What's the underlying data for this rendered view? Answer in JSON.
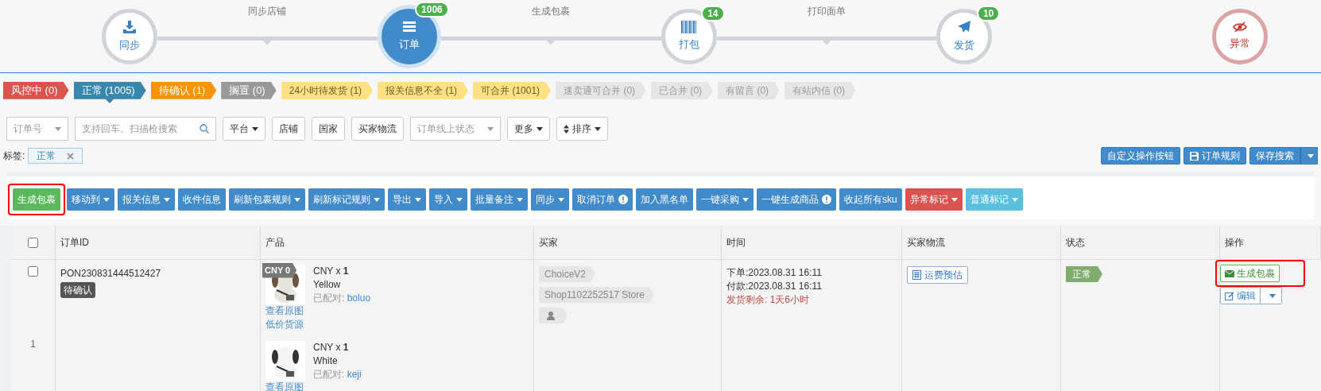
{
  "steps": [
    {
      "label": "同步",
      "selected": false,
      "kind": "normal"
    },
    {
      "link": "同步店铺"
    },
    {
      "label": "订单",
      "badge": "1006",
      "selected": true,
      "kind": "normal"
    },
    {
      "link": "生成包裹"
    },
    {
      "label": "打包",
      "badge": "14",
      "selected": false,
      "kind": "normal"
    },
    {
      "link": "打印面单"
    },
    {
      "label": "发货",
      "badge": "10",
      "selected": false,
      "kind": "normal"
    },
    {
      "label": "异常",
      "selected": false,
      "kind": "alert"
    }
  ],
  "status_tags": [
    {
      "label": "风控中 (0)",
      "color": "#d9534f",
      "selected": false
    },
    {
      "label": "正常 (1005)",
      "color": "#3a87ad",
      "selected": true
    },
    {
      "label": "待确认 (1)",
      "color": "#f89406",
      "selected": false
    },
    {
      "label": "搁置 (0)",
      "color": "#999999",
      "selected": false
    },
    {
      "label": "24小时待发货 (1)",
      "color": "#ffe083",
      "selected": false
    },
    {
      "label": "报关信息不全 (1)",
      "color": "#ffe083",
      "selected": false
    },
    {
      "label": "可合并 (1001)",
      "color": "#ffe083",
      "selected": false
    },
    {
      "label": "速卖通可合并 (0)",
      "color": "#e6e6e6",
      "selected": false
    },
    {
      "label": "已合并 (0)",
      "color": "#e6e6e6",
      "selected": false
    },
    {
      "label": "有留言 (0)",
      "color": "#e6e6e6",
      "selected": false
    },
    {
      "label": "有站内信 (0)",
      "color": "#e6e6e6",
      "selected": false
    }
  ],
  "filters": [
    {
      "kind": "select",
      "placeholder": "订单号"
    },
    {
      "kind": "search",
      "placeholder": "支持回车、扫描枪搜索"
    },
    {
      "kind": "dropdown",
      "label": "平台"
    },
    {
      "kind": "button",
      "label": "店铺"
    },
    {
      "kind": "button",
      "label": "国家"
    },
    {
      "kind": "button",
      "label": "买家物流"
    },
    {
      "kind": "select",
      "placeholder": "订单线上状态"
    },
    {
      "kind": "dropdown",
      "label": "更多"
    },
    {
      "kind": "sort",
      "label": "排序"
    }
  ],
  "label_filter": {
    "label": "标签:",
    "tag": "正常"
  },
  "right_actions": [
    {
      "label": "自定义操作按钮",
      "caret": false
    },
    {
      "label": "订单规则",
      "caret": false
    },
    {
      "label": "保存搜索",
      "caret": true
    }
  ],
  "toolbar": [
    {
      "label": "生成包裹",
      "color": "#5cb85c",
      "caret": false,
      "info": false,
      "highlighted": true
    },
    {
      "label": "移动到",
      "color": "#428bca",
      "caret": true,
      "info": false,
      "highlighted": false
    },
    {
      "label": "报关信息",
      "color": "#428bca",
      "caret": true,
      "info": false,
      "highlighted": false
    },
    {
      "label": "收件信息",
      "color": "#428bca",
      "caret": false,
      "info": false,
      "highlighted": false
    },
    {
      "label": "刷新包裹规则",
      "color": "#428bca",
      "caret": true,
      "info": false,
      "highlighted": false
    },
    {
      "label": "刷新标记规则",
      "color": "#428bca",
      "caret": true,
      "info": false,
      "highlighted": false
    },
    {
      "label": "导出",
      "color": "#428bca",
      "caret": true,
      "info": false,
      "highlighted": false
    },
    {
      "label": "导入",
      "color": "#428bca",
      "caret": true,
      "info": false,
      "highlighted": false
    },
    {
      "label": "批量备注",
      "color": "#428bca",
      "caret": true,
      "info": false,
      "highlighted": false
    },
    {
      "label": "同步",
      "color": "#428bca",
      "caret": true,
      "info": false,
      "highlighted": false
    },
    {
      "label": "取消订单",
      "color": "#428bca",
      "caret": false,
      "info": true,
      "highlighted": false
    },
    {
      "label": "加入黑名单",
      "color": "#428bca",
      "caret": false,
      "info": false,
      "highlighted": false
    },
    {
      "label": "一键采购",
      "color": "#428bca",
      "caret": true,
      "info": false,
      "highlighted": false
    },
    {
      "label": "一键生成商品",
      "color": "#428bca",
      "caret": false,
      "info": true,
      "highlighted": false
    },
    {
      "label": "收起所有sku",
      "color": "#428bca",
      "caret": false,
      "info": false,
      "highlighted": false
    },
    {
      "label": "异常标记",
      "color": "#d9534f",
      "caret": true,
      "info": false,
      "highlighted": false
    },
    {
      "label": "普通标记",
      "color": "#5bc0de",
      "caret": true,
      "info": false,
      "highlighted": false
    }
  ],
  "table": {
    "select_all_checked": false,
    "columns": [
      "订单ID",
      "产品",
      "买家",
      "时间",
      "买家物流",
      "状态",
      "操作"
    ],
    "rows": [
      {
        "checked": false,
        "index": "1",
        "order_id": "PON230831444512427",
        "order_tag": "待确认",
        "products": [
          {
            "price_badge": "CNY 0",
            "qty": "CNY x **1**",
            "variant": "Yellow",
            "matched_label": "已配对:",
            "sku": "boluo",
            "links": [
              "查看原图",
              "低价货源"
            ]
          },
          {
            "qty": "CNY x **1**",
            "variant": "White",
            "matched_label": "已配对:",
            "sku": "keji",
            "links": [
              "查看原图"
            ]
          }
        ],
        "buyer_tags": [
          {
            "kind": "text",
            "label": "ChoiceV2"
          },
          {
            "kind": "text",
            "label": "Shop1102252517 Store"
          },
          {
            "kind": "user"
          }
        ],
        "times": [
          {
            "kind": "normal",
            "text": "下单:2023.08.31 16:11"
          },
          {
            "kind": "normal",
            "text": "付款:2023.08.31 16:11"
          },
          {
            "kind": "warning",
            "text": "发货剩余: 1天6小时"
          }
        ],
        "logistics_button": "运费预估",
        "status": "正常",
        "actions": [
          {
            "kind": "primary",
            "label": "生成包裹",
            "highlighted": true
          },
          {
            "kind": "split",
            "label": "编辑",
            "highlighted": false
          }
        ]
      }
    ]
  }
}
